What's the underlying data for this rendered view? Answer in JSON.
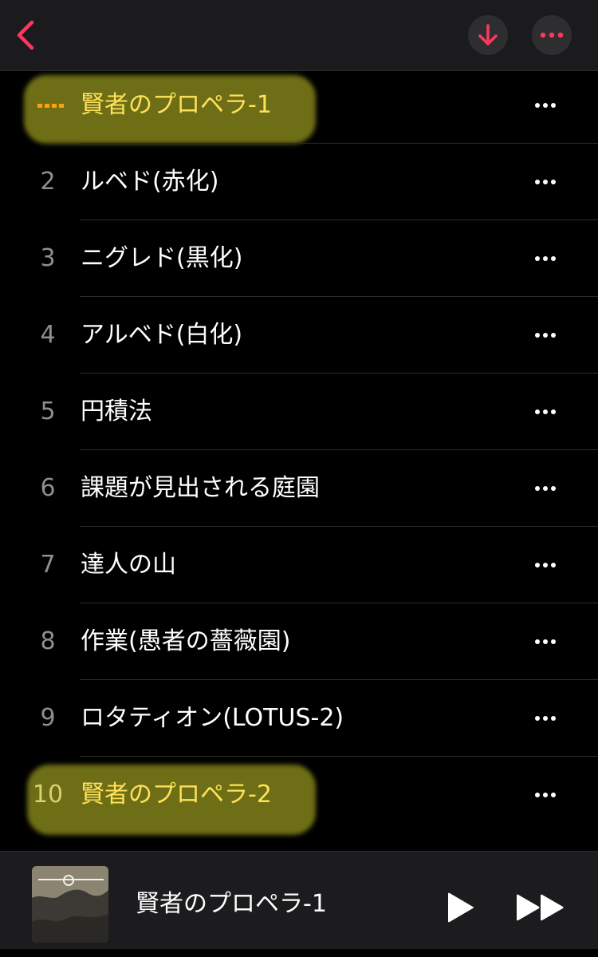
{
  "colors": {
    "accent": "#ff375f",
    "now_playing": "#ff9f0a",
    "highlight": "#c8c828"
  },
  "header": {
    "back_icon": "chevron-left-icon",
    "download_icon": "arrow-down-icon",
    "more_icon": "ellipsis-icon"
  },
  "tracks": [
    {
      "number": "",
      "title": "賢者のプロペラ-1",
      "now_playing": true,
      "highlighted": true
    },
    {
      "number": "2",
      "title": "ルベド(赤化)",
      "now_playing": false,
      "highlighted": false
    },
    {
      "number": "3",
      "title": "ニグレド(黒化)",
      "now_playing": false,
      "highlighted": false
    },
    {
      "number": "4",
      "title": "アルベド(白化)",
      "now_playing": false,
      "highlighted": false
    },
    {
      "number": "5",
      "title": "円積法",
      "now_playing": false,
      "highlighted": false
    },
    {
      "number": "6",
      "title": "課題が見出される庭園",
      "now_playing": false,
      "highlighted": false
    },
    {
      "number": "7",
      "title": "達人の山",
      "now_playing": false,
      "highlighted": false
    },
    {
      "number": "8",
      "title": "作業(愚者の薔薇園)",
      "now_playing": false,
      "highlighted": false
    },
    {
      "number": "9",
      "title": "ロタティオン(LOTUS-2)",
      "now_playing": false,
      "highlighted": false
    },
    {
      "number": "10",
      "title": "賢者のプロペラ-2",
      "now_playing": false,
      "highlighted": true
    }
  ],
  "mini_player": {
    "title": "賢者のプロペラ-1",
    "art_icon": "album-art",
    "play_icon": "play-icon",
    "forward_icon": "fast-forward-icon"
  }
}
